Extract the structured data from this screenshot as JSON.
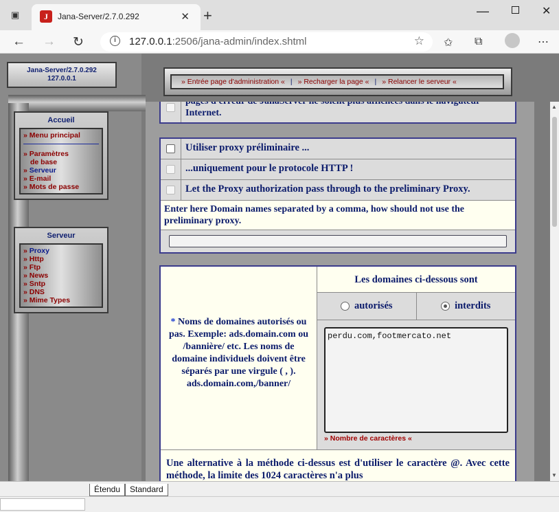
{
  "browser": {
    "tab_title": "Jana-Server/2.7.0.292",
    "url_host": "127.0.0.1",
    "url_rest": ":2506/jana-admin/index.shtml"
  },
  "sidebar": {
    "badge_line1": "Jana-Server/2.7.0.292",
    "badge_line2": "127.0.0.1",
    "accueil": {
      "title": "Accueil",
      "items": [
        {
          "label": "Menu principal"
        },
        {
          "label": "Paramètres"
        },
        {
          "label": "de base"
        },
        {
          "label": "Serveur"
        },
        {
          "label": "E-mail"
        },
        {
          "label": "Mots de passe"
        }
      ]
    },
    "serveur": {
      "title": "Serveur",
      "items": [
        {
          "label": "Proxy"
        },
        {
          "label": "Http"
        },
        {
          "label": "Ftp"
        },
        {
          "label": "News"
        },
        {
          "label": "Sntp"
        },
        {
          "label": "DNS"
        },
        {
          "label": "Mime Types"
        }
      ]
    }
  },
  "topnav": {
    "links": [
      {
        "label": "» Entrée page d'administration «"
      },
      {
        "label": "» Recharger la page «"
      },
      {
        "label": "» Relancer le serveur «"
      }
    ],
    "separator": "|"
  },
  "content": {
    "partial_row": "pages d'erreur de JanaServer ne soient plus affichées dans le navigateur Internet.",
    "proxy_options": [
      {
        "label": "Utiliser proxy préliminaire ...",
        "checked": false
      },
      {
        "label": "...uniquement pour le protocole HTTP !",
        "checked": false
      },
      {
        "label": "Let the Proxy authorization pass through to the preliminary Proxy.",
        "checked": false
      }
    ],
    "domain_note": "Enter here Domain names separated by a comma, how should not use the preliminary proxy.",
    "domain_input_value": "",
    "domains_help": {
      "star": "*",
      "text": "Noms de domaines autorisés ou pas. Exemple: ads.domain.com ou /bannière/ etc. Les noms de domaine individuels doivent être séparés par une virgule ( , ). ads.domain.com,/banner/"
    },
    "domains_heading": "Les domaines ci-dessous sont",
    "radio_allowed": "autorisés",
    "radio_forbidden": "interdits",
    "selected": "interdits",
    "textarea_value": "perdu.com,footmercato.net",
    "char_count_link": "» Nombre de caractères «",
    "alternative_text": "Une alternative à la méthode ci-dessus est d'utiliser le caractère @. Avec cette méthode, la limite des 1024 caractères n'a plus"
  },
  "sheet_tabs": [
    "Étendu",
    "Standard"
  ]
}
